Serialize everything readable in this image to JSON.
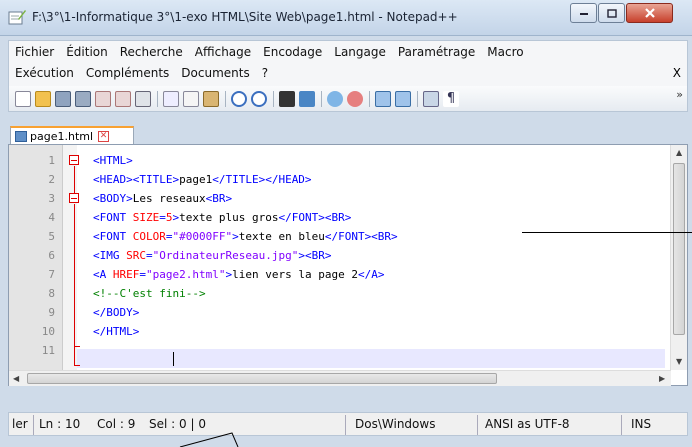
{
  "window": {
    "title": "F:\\3°\\1-Informatique 3°\\1-exo HTML\\Site Web\\page1.html - Notepad++"
  },
  "menu": {
    "row1": [
      "Fichier",
      "Édition",
      "Recherche",
      "Affichage",
      "Encodage",
      "Langage",
      "Paramétrage",
      "Macro"
    ],
    "row2": [
      "Exécution",
      "Compléments",
      "Documents",
      "?"
    ],
    "close": "X"
  },
  "toolbar": {
    "more": "»"
  },
  "tab": {
    "label": "page1.html",
    "close": "✕"
  },
  "editor": {
    "line_numbers": [
      "1",
      "2",
      "3",
      "4",
      "5",
      "6",
      "7",
      "8",
      "9",
      "10",
      "11"
    ]
  },
  "status": {
    "ler": "ler",
    "ln": "Ln : 10",
    "col": "Col : 9",
    "sel": "Sel : 0 | 0",
    "eol": "Dos\\Windows",
    "encoding": "ANSI as UTF-8",
    "mode": "INS"
  },
  "colors": {
    "tag": "#0000ff",
    "attr": "#ff0000",
    "value": "#8000ff",
    "comment": "#008000",
    "fold": "#dd0000"
  }
}
